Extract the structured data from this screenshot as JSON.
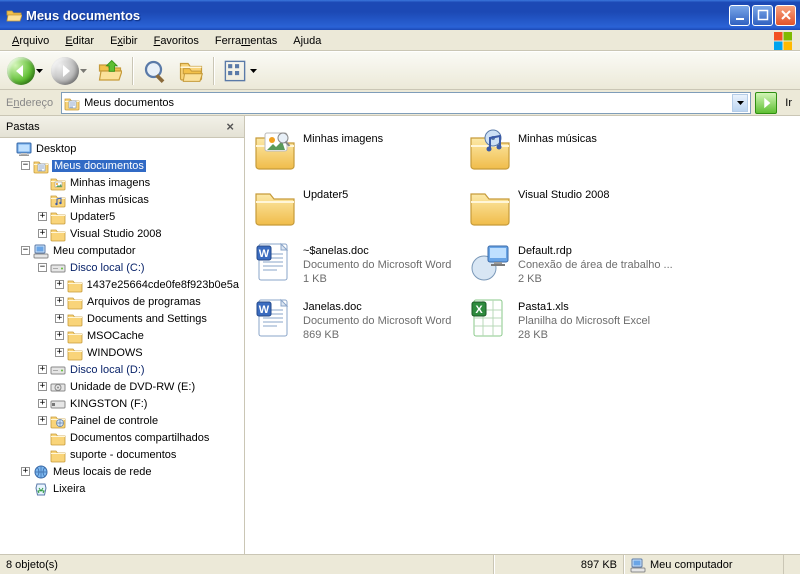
{
  "window": {
    "title": "Meus documentos"
  },
  "menu": {
    "items": [
      {
        "label": "Arquivo",
        "accel_index": 0
      },
      {
        "label": "Editar",
        "accel_index": 0
      },
      {
        "label": "Exibir",
        "accel_index": 1
      },
      {
        "label": "Favoritos",
        "accel_index": 0
      },
      {
        "label": "Ferramentas",
        "accel_index": 5
      },
      {
        "label": "Ajuda",
        "accel_index": 1
      }
    ]
  },
  "address": {
    "label": "Endereço",
    "value": "Meus documentos",
    "go_label": "Ir"
  },
  "folders_pane": {
    "title": "Pastas"
  },
  "tree": [
    {
      "depth": 0,
      "exp": "none",
      "icon": "desktop",
      "label": "Desktop"
    },
    {
      "depth": 1,
      "exp": "minus",
      "icon": "mydocs",
      "label": "Meus documentos",
      "selected": true
    },
    {
      "depth": 2,
      "exp": "none",
      "icon": "picfolder",
      "label": "Minhas imagens"
    },
    {
      "depth": 2,
      "exp": "none",
      "icon": "musicfolder",
      "label": "Minhas músicas"
    },
    {
      "depth": 2,
      "exp": "plus",
      "icon": "folder",
      "label": "Updater5"
    },
    {
      "depth": 2,
      "exp": "plus",
      "icon": "folder",
      "label": "Visual Studio 2008"
    },
    {
      "depth": 1,
      "exp": "minus",
      "icon": "mycomputer",
      "label": "Meu computador"
    },
    {
      "depth": 2,
      "exp": "minus",
      "icon": "drive",
      "label": "Disco local (C:)",
      "link": true
    },
    {
      "depth": 3,
      "exp": "plus",
      "icon": "folder",
      "label": "1437e25664cde0fe8f923b0e5a"
    },
    {
      "depth": 3,
      "exp": "plus",
      "icon": "folder",
      "label": "Arquivos de programas"
    },
    {
      "depth": 3,
      "exp": "plus",
      "icon": "folder",
      "label": "Documents and Settings"
    },
    {
      "depth": 3,
      "exp": "plus",
      "icon": "folder",
      "label": "MSOCache"
    },
    {
      "depth": 3,
      "exp": "plus",
      "icon": "folder",
      "label": "WINDOWS"
    },
    {
      "depth": 2,
      "exp": "plus",
      "icon": "drive",
      "label": "Disco local (D:)",
      "link": true
    },
    {
      "depth": 2,
      "exp": "plus",
      "icon": "cddrive",
      "label": "Unidade de DVD-RW (E:)"
    },
    {
      "depth": 2,
      "exp": "plus",
      "icon": "usbdrive",
      "label": "KINGSTON (F:)"
    },
    {
      "depth": 2,
      "exp": "plus",
      "icon": "control",
      "label": "Painel de controle"
    },
    {
      "depth": 2,
      "exp": "none",
      "icon": "sharedfolder",
      "label": "Documentos compartilhados"
    },
    {
      "depth": 2,
      "exp": "none",
      "icon": "folder",
      "label": "suporte - documentos"
    },
    {
      "depth": 1,
      "exp": "plus",
      "icon": "network",
      "label": "Meus locais de rede"
    },
    {
      "depth": 1,
      "exp": "none",
      "icon": "recycle",
      "label": "Lixeira"
    }
  ],
  "items": [
    {
      "icon": "picfolder-big",
      "name": "Minhas imagens"
    },
    {
      "icon": "musicfolder-big",
      "name": "Minhas músicas"
    },
    {
      "icon": "folder-big",
      "name": "Updater5"
    },
    {
      "icon": "folder-big",
      "name": "Visual Studio 2008"
    },
    {
      "icon": "worddoc",
      "name": "~$anelas.doc",
      "sub1": "Documento do Microsoft Word",
      "sub2": "1 KB"
    },
    {
      "icon": "rdp",
      "name": "Default.rdp",
      "sub1": "Conexão de área de trabalho ...",
      "sub2": "2 KB"
    },
    {
      "icon": "worddoc",
      "name": "Janelas.doc",
      "sub1": "Documento do Microsoft Word",
      "sub2": "869 KB"
    },
    {
      "icon": "excel",
      "name": "Pasta1.xls",
      "sub1": "Planilha do Microsoft Excel",
      "sub2": "28 KB"
    }
  ],
  "status": {
    "count": "8 objeto(s)",
    "size": "897 KB",
    "zone": "Meu computador"
  }
}
